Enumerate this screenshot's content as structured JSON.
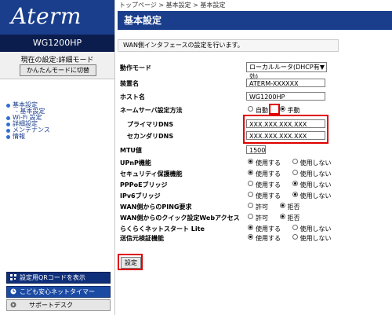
{
  "sidebar": {
    "logo": "Aterm",
    "model": "WG1200HP",
    "mode_label": "現在の設定:詳細モード",
    "mode_button": "かんたんモードに切替",
    "nav": [
      {
        "label": "基本設定",
        "sub": false
      },
      {
        "label": "- 基本設定",
        "sub": true
      },
      {
        "label": "Wi-Fi 設定",
        "sub": false
      },
      {
        "label": "詳細設定",
        "sub": false
      },
      {
        "label": "メンテナンス",
        "sub": false
      },
      {
        "label": "情報",
        "sub": false
      }
    ],
    "qr_button": "設定用QRコードを表示",
    "timer_button": "こども安心ネットタイマー",
    "support_button": "サポートデスク"
  },
  "breadcrumb": "トップページ > 基本設定 > 基本設定",
  "page_title": "基本設定",
  "description": "WAN側インタフェースの設定を行います。",
  "form": {
    "operation_mode": {
      "label": "動作モード",
      "value": "ローカルルータ(DHCP有効)"
    },
    "device_name": {
      "label": "装置名",
      "value": "ATERM-XXXXXX"
    },
    "host_name": {
      "label": "ホスト名",
      "value": "WG1200HP"
    },
    "dns_method": {
      "label": "ネームサーバ設定方法",
      "options": [
        "自動",
        "手動"
      ],
      "selected": "手動"
    },
    "primary_dns": {
      "label": "プライマリDNS",
      "value": "XXX.XXX.XXX.XXX"
    },
    "secondary_dns": {
      "label": "セカンダリDNS",
      "value": "XXX.XXX.XXX.XXX"
    },
    "mtu": {
      "label": "MTU値",
      "value": "1500"
    },
    "upnp": {
      "label": "UPnP機能",
      "options": [
        "使用する",
        "使用しない"
      ],
      "selected": "使用する"
    },
    "security": {
      "label": "セキュリティ保護機能",
      "options": [
        "使用する",
        "使用しない"
      ],
      "selected": "使用する"
    },
    "pppoe_bridge": {
      "label": "PPPoEブリッジ",
      "options": [
        "使用する",
        "使用しない"
      ],
      "selected": "使用しない"
    },
    "ipv6_bridge": {
      "label": "IPv6ブリッジ",
      "options": [
        "使用する",
        "使用しない"
      ],
      "selected": "使用しない"
    },
    "wan_ping": {
      "label": "WAN側からのPING要求",
      "options": [
        "許可",
        "拒否"
      ],
      "selected": "拒否"
    },
    "wan_web": {
      "label": "WAN側からのクイック設定Webアクセス",
      "options": [
        "許可",
        "拒否"
      ],
      "selected": "拒否"
    },
    "easy_start": {
      "label": "らくらくネットスタート Lite",
      "options": [
        "使用する",
        "使用しない"
      ],
      "selected": "使用する"
    },
    "source_verify": {
      "label": "送信元検証機能",
      "options": [
        "使用する",
        "使用しない"
      ],
      "selected": "使用する"
    }
  },
  "submit_button": "設定",
  "colors": {
    "header": "#1a3e8c",
    "highlight": "#e00000"
  }
}
